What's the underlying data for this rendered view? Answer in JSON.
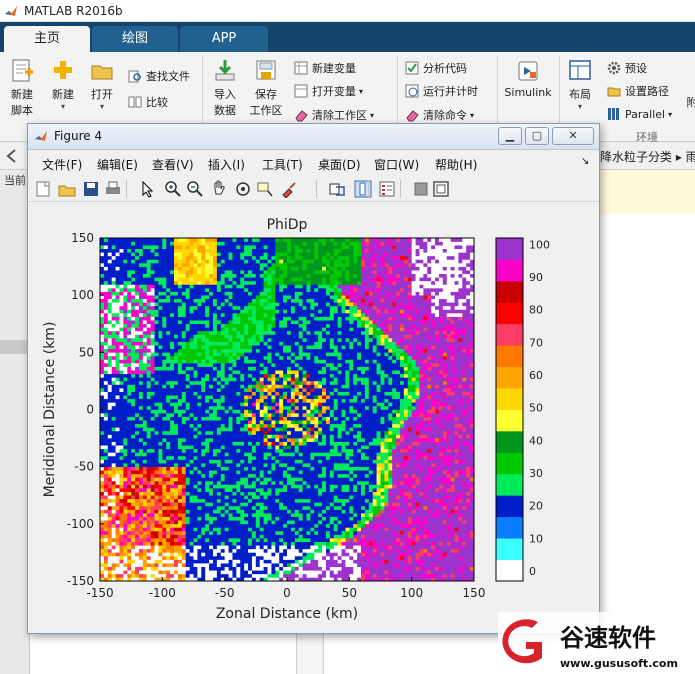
{
  "app": {
    "title": "MATLAB R2016b"
  },
  "tabs": [
    {
      "label": "主页",
      "active": true
    },
    {
      "label": "绘图",
      "active": false
    },
    {
      "label": "APP",
      "active": false
    }
  ],
  "ribbon": {
    "new_script": "新建\n脚本",
    "new": "新建",
    "open": "打开",
    "find_files": "查找文件",
    "compare": "比较",
    "import_data": "导入\n数据",
    "save_workspace": "保存\n工作区",
    "new_variable": "新建变量",
    "open_variable": "打开变量",
    "clear_workspace": "清除工作区",
    "analyze_code": "分析代码",
    "run_and_time": "运行并计时",
    "clear_commands": "清除命令",
    "simulink": "Simulink",
    "layout": "布局",
    "preferences": "预设",
    "set_path": "设置路径",
    "parallel": "Parallel",
    "more": "附",
    "environment_group": "环境"
  },
  "breadcrumb": "降水粒子分类 ▸ 雨",
  "left_label": "当前",
  "figure": {
    "title": "Figure 4",
    "menu": [
      "文件(F)",
      "编辑(E)",
      "查看(V)",
      "插入(I)",
      "工具(T)",
      "桌面(D)",
      "窗口(W)",
      "帮助(H)"
    ],
    "toolbar_icons": [
      "new-figure-icon",
      "open-file-icon",
      "save-icon",
      "print-icon",
      "pointer-icon",
      "zoom-in-icon",
      "zoom-out-icon",
      "pan-icon",
      "rotate-icon",
      "data-cursor-icon",
      "brush-icon",
      "link-icon",
      "colorbar-icon",
      "legend-icon",
      "hide-plot-tools-icon",
      "show-plot-tools-icon"
    ],
    "win_buttons": [
      "minimize",
      "maximize",
      "close"
    ]
  },
  "chart_data": {
    "type": "heatmap",
    "title": "PhiDp",
    "xlabel": "Zonal Distance (km)",
    "ylabel": "Meridional Distance (km)",
    "xlim": [
      -150,
      150
    ],
    "ylim": [
      -150,
      150
    ],
    "xticks": [
      "-150",
      "-100",
      "-50",
      "0",
      "50",
      "100",
      "150"
    ],
    "yticks": [
      "150",
      "100",
      "50",
      "0",
      "-50",
      "-100",
      "-150"
    ],
    "colorbar": {
      "ticks": [
        "0",
        "10",
        "20",
        "30",
        "40",
        "50",
        "60",
        "70",
        "80",
        "90",
        "100"
      ],
      "range": [
        0,
        105
      ],
      "colors": [
        "#ffffff",
        "#39ffff",
        "#0a7dff",
        "#001ec8",
        "#00eb5a",
        "#00c800",
        "#00961e",
        "#ffff32",
        "#ffd700",
        "#ffa500",
        "#ff7800",
        "#ff3c64",
        "#ff0000",
        "#c80000",
        "#ff00c8",
        "#9b33cc"
      ]
    },
    "description_regions": {
      "background": 25,
      "east_band": 105,
      "ring": 33,
      "nw_band": 33,
      "ne_patch": 40,
      "sw_patch": 75,
      "north_patch": 55,
      "center_noise": 70
    },
    "grid": false
  },
  "watermark": {
    "brand": "谷速软件",
    "url": "www.gususoft.com"
  }
}
